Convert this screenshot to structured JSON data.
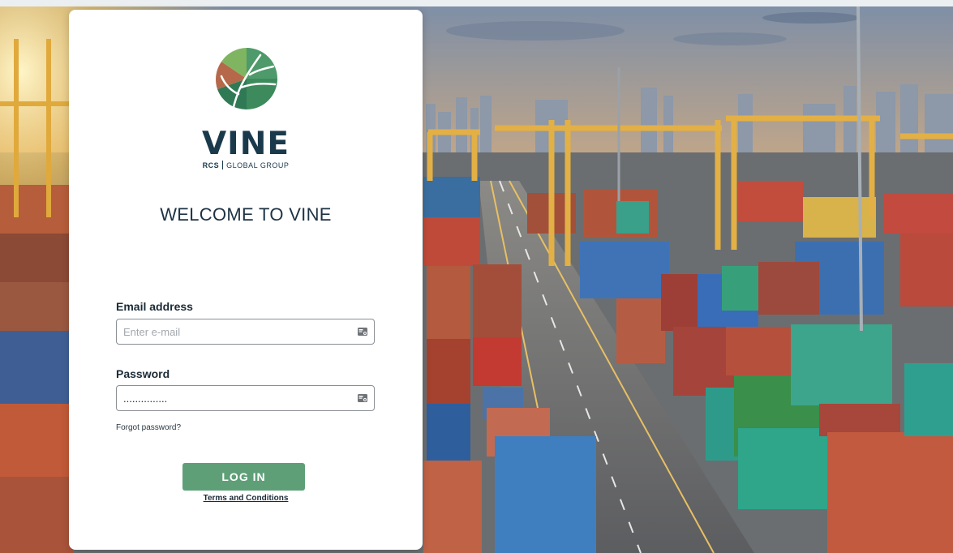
{
  "brand": {
    "name": "VINE",
    "sub_rcs": "RCS",
    "sub_group": "GLOBAL GROUP"
  },
  "welcome": "WELCOME TO VINE",
  "form": {
    "email_label": "Email address",
    "email_placeholder": "Enter e-mail",
    "email_value": "",
    "password_label": "Password",
    "password_value": "...............",
    "forgot_label": "Forgot password?",
    "login_label": "LOG IN",
    "terms_label": "Terms and Conditions"
  },
  "icons": {
    "logo": "vine-leaf-logo-icon",
    "email_field": "credential-card-icon",
    "password_field": "credential-card-icon"
  },
  "colors": {
    "brand_navy": "#1a3a4c",
    "button_green": "#5f9f78",
    "card_bg": "#ffffff"
  }
}
